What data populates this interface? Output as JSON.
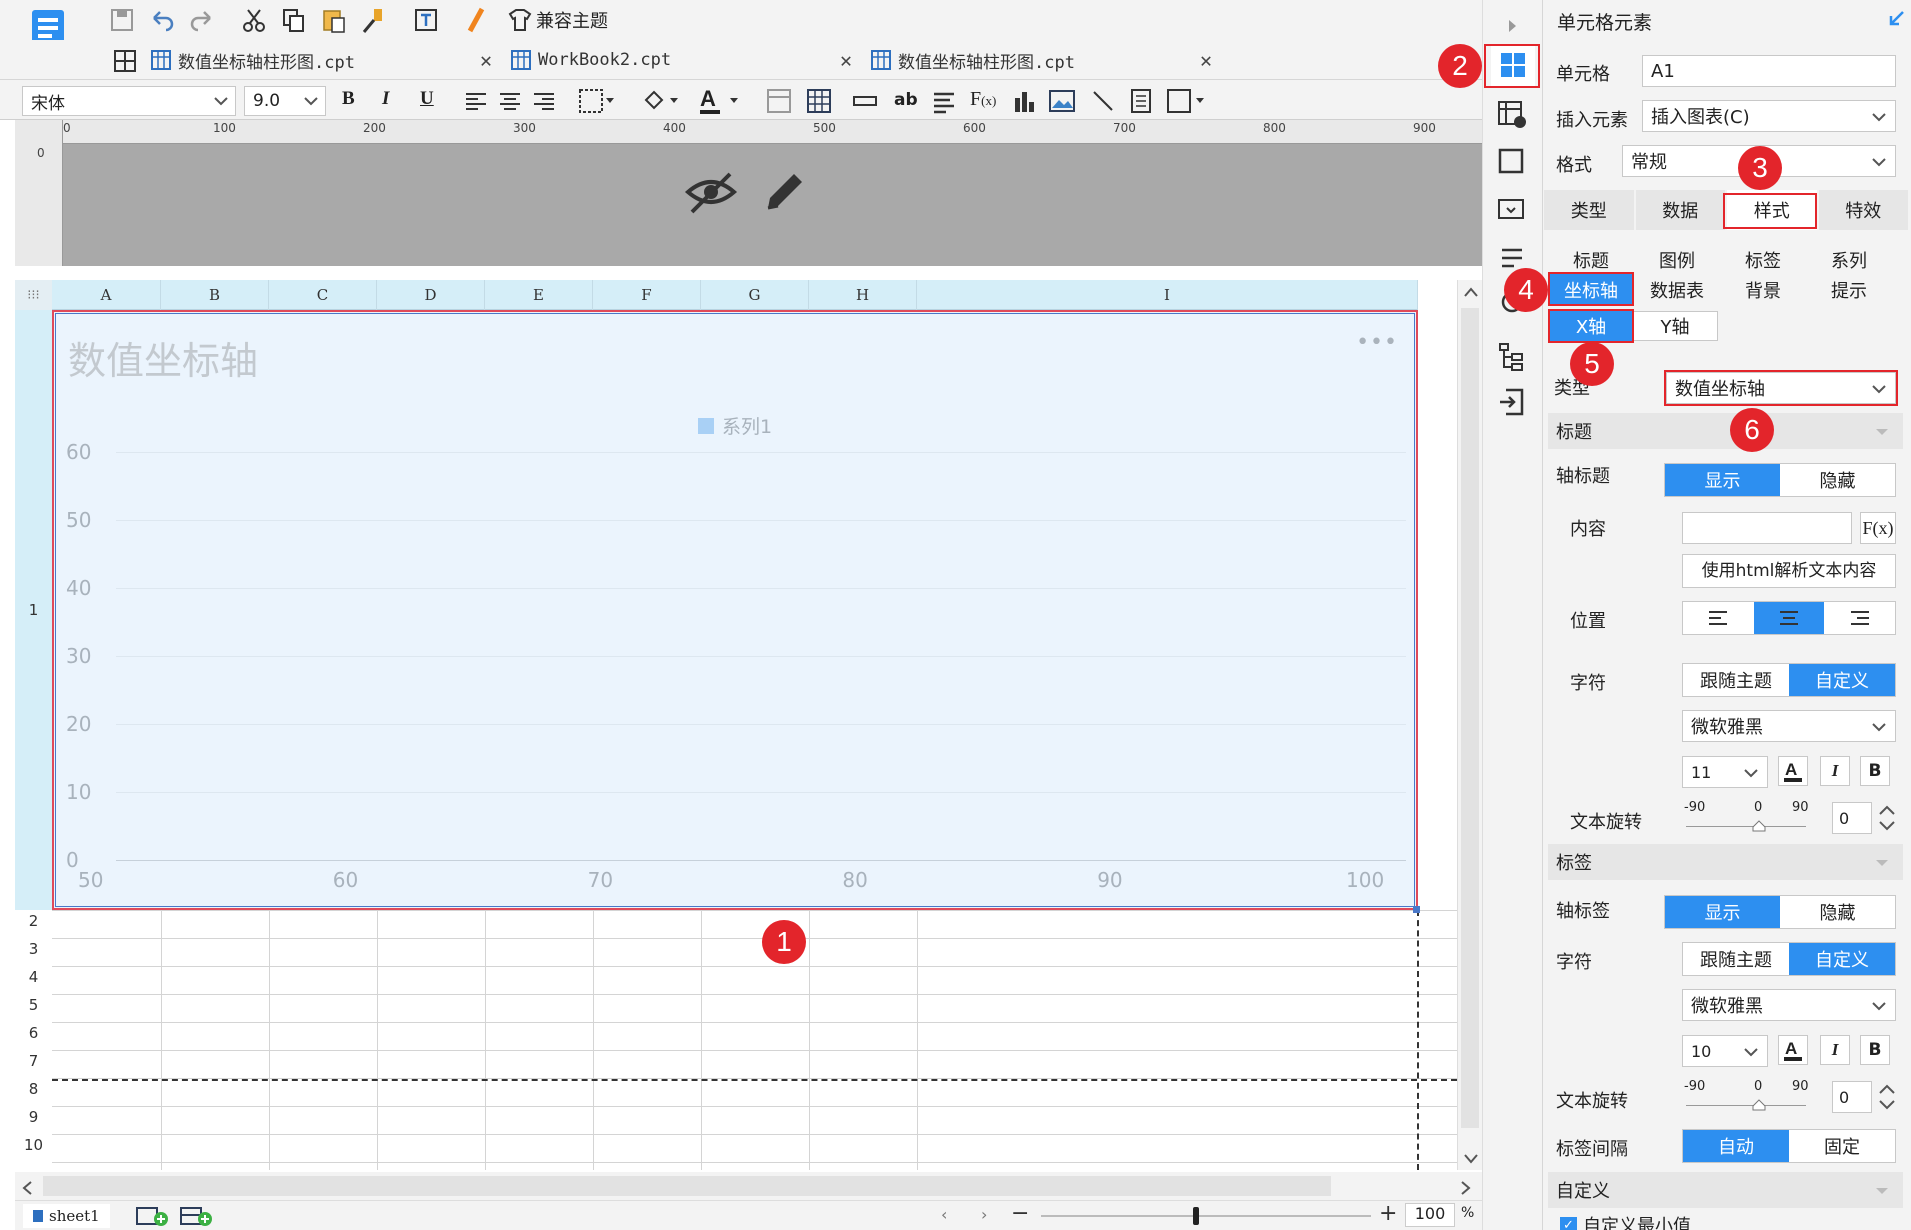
{
  "toolbar": {
    "theme_button_label": "兼容主题"
  },
  "tabs": [
    {
      "label": "数值坐标轴柱形图.cpt"
    },
    {
      "label": "WorkBook2.cpt"
    },
    {
      "label": "数值坐标轴柱形图.cpt"
    }
  ],
  "format_bar": {
    "font_family": "宋体",
    "font_size": "9.0"
  },
  "ruler": {
    "ticks": [
      "0",
      "100",
      "200",
      "300",
      "400",
      "500",
      "600",
      "700",
      "800",
      "900"
    ]
  },
  "grid": {
    "columns": [
      "A",
      "B",
      "C",
      "D",
      "E",
      "F",
      "G",
      "H",
      "I"
    ],
    "rows": [
      "1",
      "2",
      "3",
      "4",
      "5",
      "6",
      "7",
      "8",
      "9",
      "10"
    ]
  },
  "chart_data": {
    "type": "bar",
    "title": "数值坐标轴",
    "legend": [
      "系列1"
    ],
    "legend_position": "top",
    "series": [
      {
        "name": "系列1",
        "values": []
      }
    ],
    "x_ticks": [
      "50",
      "60",
      "70",
      "80",
      "90",
      "100"
    ],
    "y_ticks": [
      "60",
      "50",
      "40",
      "30",
      "20",
      "10",
      "0"
    ],
    "xlim": [
      50,
      100
    ],
    "ylim": [
      0,
      60
    ],
    "grid": true
  },
  "statusbar": {
    "sheet_name": "sheet1",
    "zoom": "100",
    "zoom_unit": "%"
  },
  "panel": {
    "title": "单元格元素",
    "cell_label": "单元格",
    "cell_value": "A1",
    "insert_label": "插入元素",
    "insert_value": "插入图表(C)",
    "format_label": "格式",
    "format_value": "常规",
    "main_tabs": [
      "类型",
      "数据",
      "样式",
      "特效"
    ],
    "style_tabs": [
      "标题",
      "图例",
      "标签",
      "系列",
      "坐标轴",
      "数据表",
      "背景",
      "提示"
    ],
    "axis_tabs": [
      "X轴",
      "Y轴"
    ],
    "type_label": "类型",
    "type_value": "数值坐标轴",
    "title_section": "标题",
    "axis_title_label": "轴标题",
    "show": "显示",
    "hide": "隐藏",
    "content_label": "内容",
    "fx_label": "F(x)",
    "html_button": "使用html解析文本内容",
    "position_label": "位置",
    "char_label": "字符",
    "follow_theme": "跟随主题",
    "custom": "自定义",
    "font_name": "微软雅黑",
    "title_font_size": "11",
    "rotate_label": "文本旋转",
    "rotate_min": "-90",
    "rotate_mid": "0",
    "rotate_max": "90",
    "rotate_value": "0",
    "label_section": "标签",
    "axis_label_label": "轴标签",
    "label_font_size": "10",
    "label_interval_label": "标签间隔",
    "auto": "自动",
    "fixed": "固定",
    "custom_section": "自定义",
    "custom_min_label": "自定义最小值"
  },
  "markers": [
    "1",
    "2",
    "3",
    "4",
    "5",
    "6"
  ],
  "colors": {
    "accent": "#2d8ff0",
    "highlight": "#e3252b",
    "chart_bg": "#ebf4fd",
    "header_bg": "#d5eef8"
  }
}
